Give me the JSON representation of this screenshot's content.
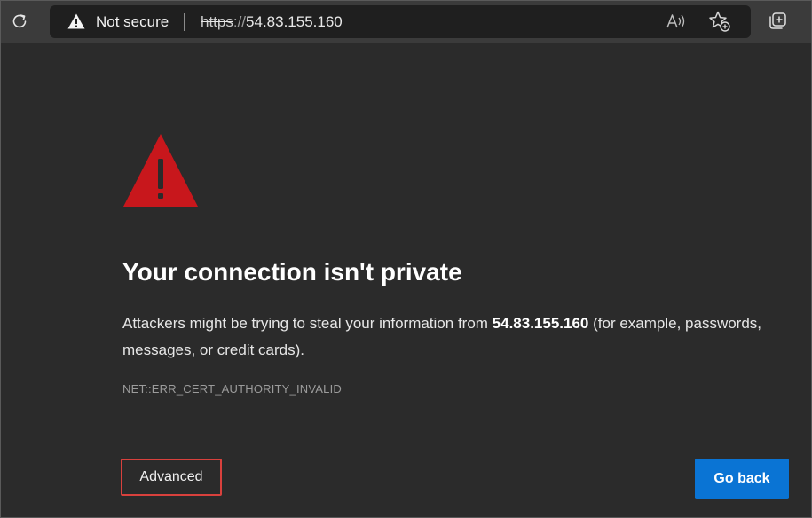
{
  "toolbar": {
    "security_label": "Not secure",
    "url": {
      "scheme": "https",
      "separator": "://",
      "host": "54.83.155.160"
    }
  },
  "error": {
    "title": "Your connection isn't private",
    "message_before": "Attackers might be trying to steal your information from ",
    "message_host": "54.83.155.160",
    "message_after": " (for example, passwords, messages, or credit cards).",
    "code": "NET::ERR_CERT_AUTHORITY_INVALID"
  },
  "buttons": {
    "advanced_label": "Advanced",
    "go_back_label": "Go back"
  },
  "icons": {
    "refresh": "refresh-icon",
    "security_warning": "warning-icon",
    "read_aloud": "read-aloud-icon",
    "favorite": "add-favorite-icon",
    "collections": "collections-icon",
    "error_warning": "large-warning-icon"
  },
  "colors": {
    "warning_red": "#c8171c",
    "primary_button": "#0a74d4",
    "highlight_border": "#d9413d",
    "page_background": "#2b2b2b"
  }
}
